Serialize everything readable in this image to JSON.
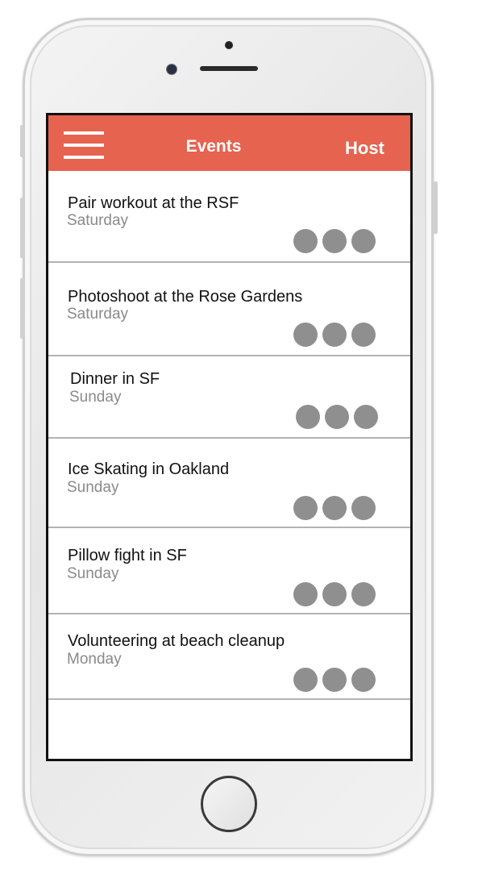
{
  "header": {
    "title": "Events",
    "host_label": "Host",
    "accent_color": "#e6634f"
  },
  "events": [
    {
      "title": "Pair workout at the RSF",
      "day": "Saturday",
      "attendees": 3
    },
    {
      "title": "Photoshoot at the Rose Gardens",
      "day": "Saturday",
      "attendees": 3
    },
    {
      "title": "Dinner in SF",
      "day": "Sunday",
      "attendees": 3
    },
    {
      "title": "Ice Skating in Oakland",
      "day": "Sunday",
      "attendees": 3
    },
    {
      "title": "Pillow fight in SF",
      "day": "Sunday",
      "attendees": 3
    },
    {
      "title": "Volunteering at beach cleanup",
      "day": "Monday",
      "attendees": 3
    }
  ],
  "icons": {
    "menu": "hamburger-menu-icon",
    "avatar": "avatar-placeholder"
  }
}
